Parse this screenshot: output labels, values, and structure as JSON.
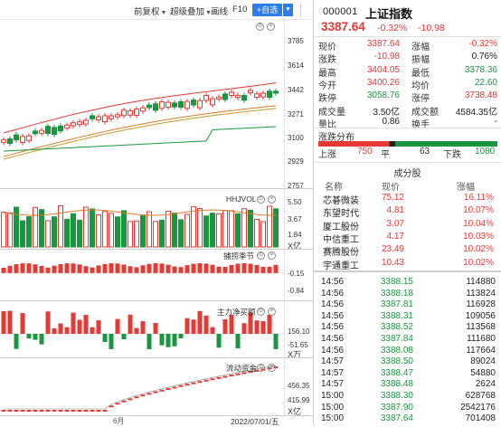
{
  "toolbar": {
    "items": [
      "前复权",
      "超级叠加",
      "画线",
      "F10"
    ],
    "add_button": "+自选",
    "dropdown": "▼"
  },
  "kline": {
    "axis_labels": [
      "3785",
      "3614",
      "3442",
      "3271",
      "3100",
      "2929",
      "2757"
    ]
  },
  "hhjvol": {
    "title": "HHJVOL",
    "axis_labels": [
      "5.50",
      "3.67",
      "1.84",
      "X亿"
    ]
  },
  "capture": {
    "title": "捕捞季节",
    "axis_labels": [
      "-0.15",
      "-0.84"
    ]
  },
  "mainforce": {
    "title": "主力净买额",
    "axis_labels": [
      "156.10",
      "-51.65",
      "X万"
    ]
  },
  "flow": {
    "title": "流动资金",
    "axis_labels": [
      "456.35",
      "415.99",
      "X亿"
    ]
  },
  "xaxis": {
    "month_label": "6月",
    "date_label": "2022/07/01/五"
  },
  "quote": {
    "code": "000001",
    "name": "上证指数",
    "price": "3387.64",
    "change_pct": "-0.32%",
    "change": "-10.98",
    "rows": [
      {
        "l1": "现价",
        "v1": "3387.64",
        "c1": "red",
        "l2": "涨幅",
        "v2": "-0.32%",
        "c2": "red"
      },
      {
        "l1": "涨跌",
        "v1": "-10.98",
        "c1": "red",
        "l2": "振幅",
        "v2": "0.76%",
        "c2": "dark"
      },
      {
        "l1": "最高",
        "v1": "3404.05",
        "c1": "red",
        "l2": "最低",
        "v2": "3378.36",
        "c2": "green"
      },
      {
        "l1": "今开",
        "v1": "3400.26",
        "c1": "red",
        "l2": "均价",
        "v2": "22.60",
        "c2": "green"
      },
      {
        "l1": "跌停",
        "v1": "3058.76",
        "c1": "green",
        "l2": "涨停",
        "v2": "3738.48",
        "c2": "red"
      },
      {
        "l1": "成交量",
        "v1": "3.50亿",
        "c1": "dark",
        "l2": "成交额",
        "v2": "4584.35亿",
        "c2": "dark"
      },
      {
        "l1": "量比",
        "v1": "0.86",
        "c1": "dark",
        "l2": "换手",
        "v2": "-",
        "c2": "dark"
      }
    ]
  },
  "distribution": {
    "title": "涨跌分布",
    "up_label": "上涨",
    "up_count": "750",
    "flat_label": "平",
    "flat_count": "63",
    "down_label": "下跌",
    "down_count": "1080"
  },
  "constituents": {
    "title": "成分股",
    "headers": [
      "名称",
      "现价",
      "涨幅"
    ],
    "rows": [
      {
        "name": "芯碁微装",
        "price": "75.12",
        "pct": "16.11%"
      },
      {
        "name": "东望时代",
        "price": "4.81",
        "pct": "10.07%"
      },
      {
        "name": "厦工股份",
        "price": "3.07",
        "pct": "10.04%"
      },
      {
        "name": "中信重工",
        "price": "4.17",
        "pct": "10.03%"
      },
      {
        "name": "赛腾股份",
        "price": "23.49",
        "pct": "10.02%"
      },
      {
        "name": "宇通重工",
        "price": "10.43",
        "pct": "10.02%"
      }
    ]
  },
  "ticks": [
    {
      "time": "14:56",
      "price": "3388.15",
      "vol": "114880",
      "c": "green"
    },
    {
      "time": "14:56",
      "price": "3388.18",
      "vol": "113824",
      "c": "green"
    },
    {
      "time": "14:56",
      "price": "3387.81",
      "vol": "116928",
      "c": "green"
    },
    {
      "time": "14:56",
      "price": "3388.31",
      "vol": "109056",
      "c": "green"
    },
    {
      "time": "14:56",
      "price": "3388.52",
      "vol": "113568",
      "c": "green"
    },
    {
      "time": "14:56",
      "price": "3387.84",
      "vol": "111680",
      "c": "green"
    },
    {
      "time": "14:56",
      "price": "3388.08",
      "vol": "117664",
      "c": "green"
    },
    {
      "time": "14:57",
      "price": "3388.50",
      "vol": "89024",
      "c": "green"
    },
    {
      "time": "14:57",
      "price": "3388.47",
      "vol": "54880",
      "c": "green"
    },
    {
      "time": "14:57",
      "price": "3388.48",
      "vol": "2624",
      "c": "green"
    },
    {
      "time": "15:00",
      "price": "3388.30",
      "vol": "628768",
      "c": "green"
    },
    {
      "time": "15:00",
      "price": "3387.90",
      "vol": "2542176",
      "c": "green"
    },
    {
      "time": "15:00",
      "price": "3387.64",
      "vol": "701408",
      "c": "green"
    }
  ],
  "colors": {
    "up": "#e53935",
    "down": "#1a9641",
    "accent": "#2b7de9"
  }
}
